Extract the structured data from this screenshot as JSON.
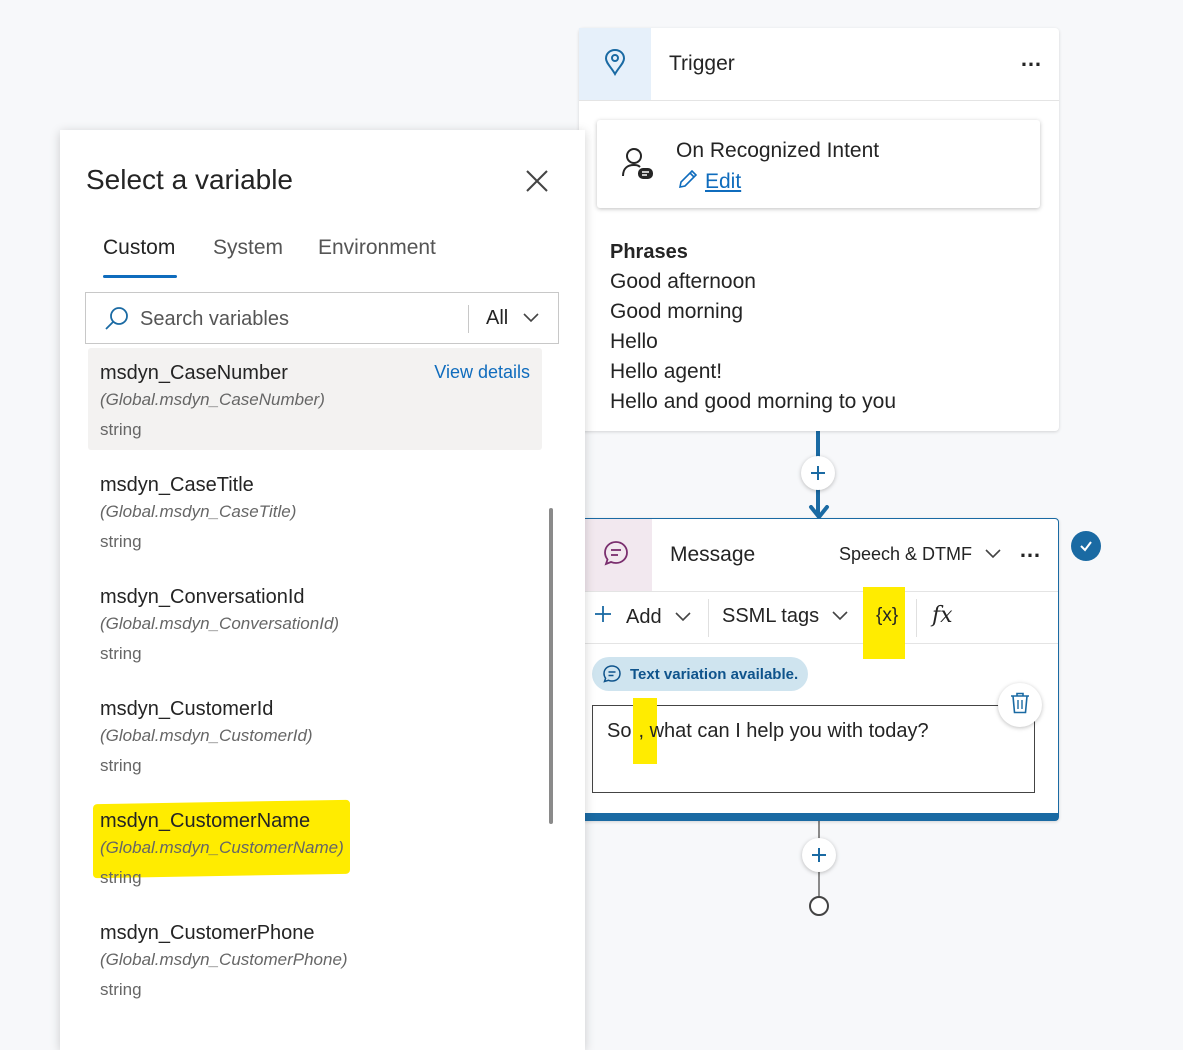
{
  "trigger_card": {
    "title": "Trigger",
    "more_label": "…",
    "intent": {
      "title": "On Recognized Intent",
      "edit_label": "Edit"
    },
    "phrases_title": "Phrases",
    "phrases": [
      "Good afternoon",
      "Good morning",
      "Hello",
      "Hello agent!",
      "Hello and good morning to you"
    ]
  },
  "message_card": {
    "title": "Message",
    "mode_label": "Speech & DTMF",
    "more_label": "…",
    "toolbar": {
      "add_label": "Add",
      "ssml_label": "SSML tags",
      "variable_label": "{x}",
      "formula_label": "fx"
    },
    "variation_badge": "Text variation available.",
    "text_parts": [
      "So",
      ",",
      " what can I help you with today?"
    ]
  },
  "variable_panel": {
    "title": "Select a variable",
    "tabs": [
      {
        "label": "Custom",
        "active": true
      },
      {
        "label": "System",
        "active": false
      },
      {
        "label": "Environment",
        "active": false
      }
    ],
    "search": {
      "placeholder": "Search variables",
      "value": ""
    },
    "filter": "All",
    "view_details_label": "View details",
    "variables": [
      {
        "name": "msdyn_CaseNumber",
        "path": "(Global.msdyn_CaseNumber)",
        "type": "string"
      },
      {
        "name": "msdyn_CaseTitle",
        "path": "(Global.msdyn_CaseTitle)",
        "type": "string"
      },
      {
        "name": "msdyn_ConversationId",
        "path": "(Global.msdyn_ConversationId)",
        "type": "string"
      },
      {
        "name": "msdyn_CustomerId",
        "path": "(Global.msdyn_CustomerId)",
        "type": "string"
      },
      {
        "name": "msdyn_CustomerName",
        "path": "(Global.msdyn_CustomerName)",
        "type": "string"
      },
      {
        "name": "msdyn_CustomerPhone",
        "path": "(Global.msdyn_CustomerPhone)",
        "type": "string"
      }
    ]
  },
  "colors": {
    "accent": "#1a6aa3",
    "link": "#0f6cbd",
    "highlight": "#ffec00",
    "hover_row": "#f3f2f1",
    "badge_bg": "#cfe4ef"
  },
  "icons": {
    "trigger": "trigger-pin-icon",
    "intent": "person-chat-icon",
    "edit": "pencil-icon",
    "message": "chat-bubble-icon",
    "close": "close-icon",
    "search": "search-icon",
    "chevron": "chevron-down-icon",
    "trash": "trash-icon",
    "check": "checkmark-icon"
  }
}
